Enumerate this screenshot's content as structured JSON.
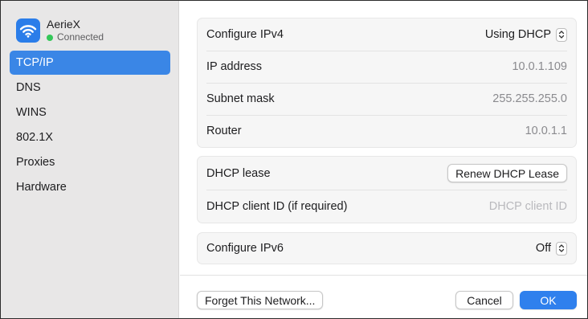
{
  "network": {
    "name": "AerieX",
    "status": "Connected",
    "icon": "wifi-icon"
  },
  "sidebar": {
    "items": [
      {
        "label": "TCP/IP",
        "active": true
      },
      {
        "label": "DNS"
      },
      {
        "label": "WINS"
      },
      {
        "label": "802.1X"
      },
      {
        "label": "Proxies"
      },
      {
        "label": "Hardware"
      }
    ]
  },
  "ipv4": {
    "configure_label": "Configure IPv4",
    "configure_value": "Using DHCP",
    "ip_label": "IP address",
    "ip_value": "10.0.1.109",
    "subnet_label": "Subnet mask",
    "subnet_value": "255.255.255.0",
    "router_label": "Router",
    "router_value": "10.0.1.1"
  },
  "dhcp": {
    "lease_label": "DHCP lease",
    "renew_button": "Renew DHCP Lease",
    "client_id_label": "DHCP client ID (if required)",
    "client_id_placeholder": "DHCP client ID"
  },
  "ipv6": {
    "configure_label": "Configure IPv6",
    "configure_value": "Off"
  },
  "footer": {
    "forget_button": "Forget This Network...",
    "cancel_button": "Cancel",
    "ok_button": "OK"
  },
  "colors": {
    "accent": "#3a86e6",
    "status_ok": "#34c759",
    "wifi_badge": "#2b7de9"
  }
}
